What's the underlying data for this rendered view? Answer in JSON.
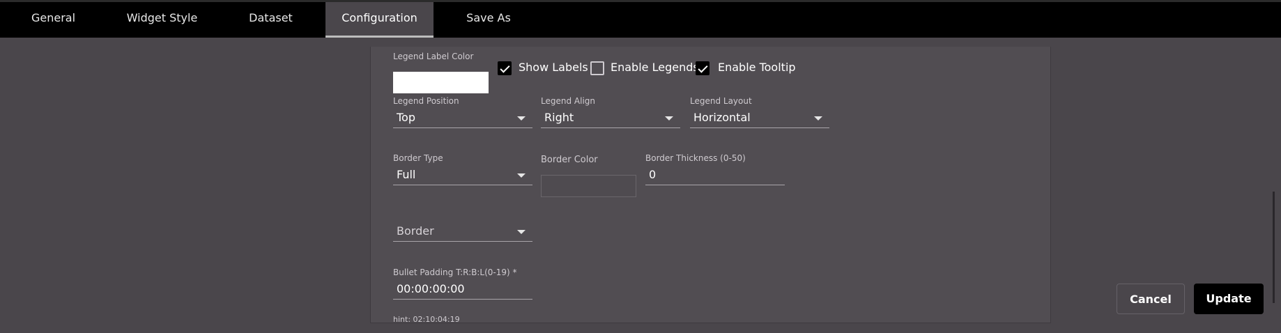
{
  "tabs": [
    {
      "label": "General"
    },
    {
      "label": "Widget Style"
    },
    {
      "label": "Dataset"
    },
    {
      "label": "Configuration"
    },
    {
      "label": "Save As"
    }
  ],
  "legend": {
    "label_color_label": "Legend Label Color",
    "label_color_value": "#ffffff",
    "show_labels": {
      "label": "Show Labels",
      "checked": true
    },
    "enable_legends": {
      "label": "Enable Legends",
      "checked": false
    },
    "enable_tooltip": {
      "label": "Enable Tooltip",
      "checked": true
    },
    "position": {
      "label": "Legend Position",
      "value": "Top"
    },
    "align": {
      "label": "Legend Align",
      "value": "Right"
    },
    "layout": {
      "label": "Legend Layout",
      "value": "Horizontal"
    }
  },
  "border": {
    "type": {
      "label": "Border Type",
      "value": "Full"
    },
    "color": {
      "label": "Border Color"
    },
    "thickness": {
      "label": "Border Thickness (0-50)",
      "value": "0"
    },
    "select": {
      "placeholder": "Border"
    }
  },
  "bullet_padding": {
    "label": "Bullet Padding T:R:B:L(0-19) *",
    "value": "00:00:00:00",
    "hint": "hint: 02:10:04:19"
  },
  "actions": {
    "cancel_label": "Cancel",
    "update_label": "Update"
  },
  "colors": {
    "background": "#4a464b",
    "panel": "#514d52",
    "topbar": "#000000"
  }
}
